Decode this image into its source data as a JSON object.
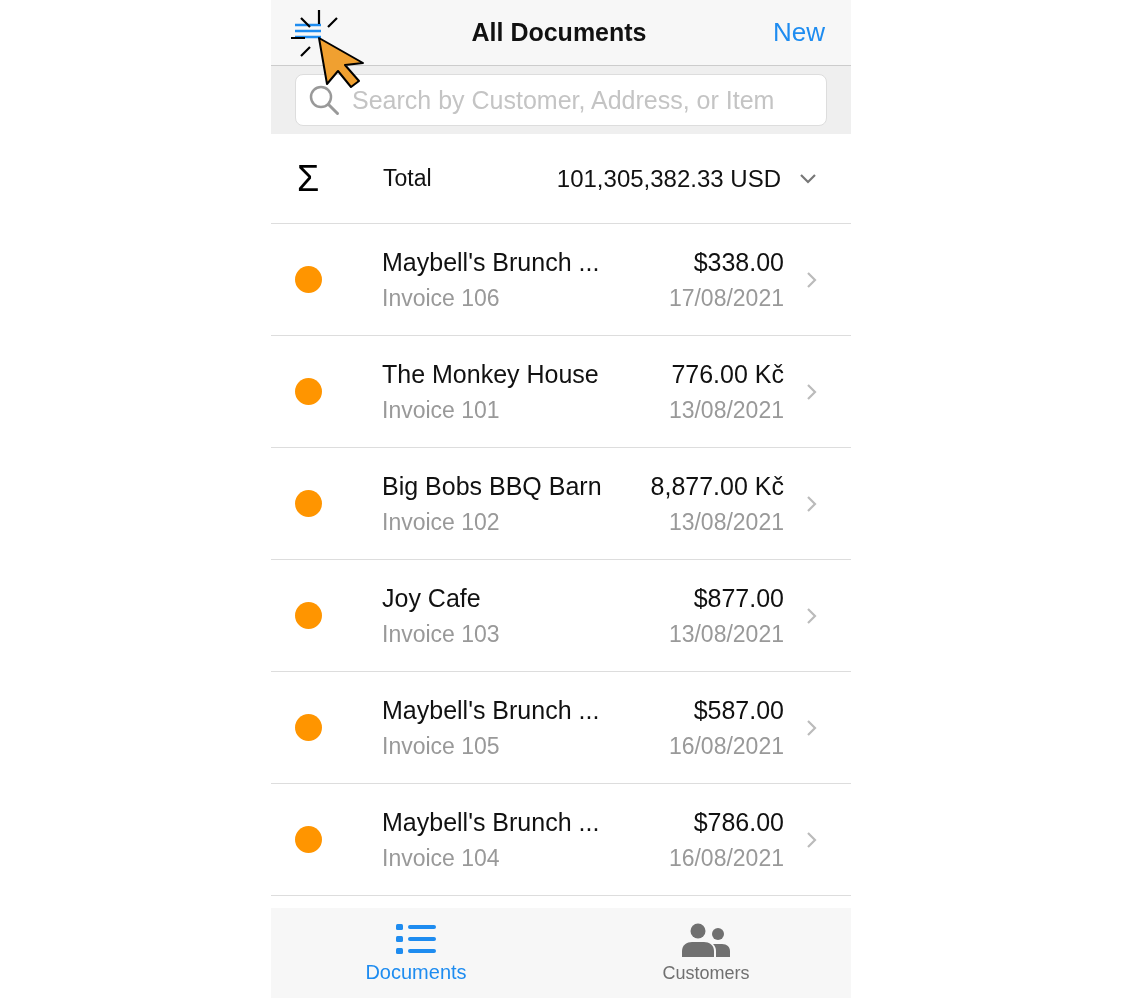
{
  "nav": {
    "title": "All Documents",
    "action": "New"
  },
  "search": {
    "placeholder": "Search by Customer, Address, or Item"
  },
  "total": {
    "symbol": "Σ",
    "label": "Total",
    "value": "101,305,382.33 USD"
  },
  "documents": [
    {
      "customer": "Maybell's Brunch ...",
      "number": "Invoice 106",
      "amount": "$338.00",
      "date": "17/08/2021",
      "color": "#ff9500"
    },
    {
      "customer": "The Monkey House",
      "number": "Invoice 101",
      "amount": "776.00 Kč",
      "date": "13/08/2021",
      "color": "#ff9500"
    },
    {
      "customer": "Big Bobs BBQ Barn",
      "number": "Invoice 102",
      "amount": "8,877.00 Kč",
      "date": "13/08/2021",
      "color": "#ff9500"
    },
    {
      "customer": "Joy Cafe",
      "number": "Invoice 103",
      "amount": "$877.00",
      "date": "13/08/2021",
      "color": "#ff9500"
    },
    {
      "customer": "Maybell's Brunch ...",
      "number": "Invoice 105",
      "amount": "$587.00",
      "date": "16/08/2021",
      "color": "#ff9500"
    },
    {
      "customer": "Maybell's Brunch ...",
      "number": "Invoice 104",
      "amount": "$786.00",
      "date": "16/08/2021",
      "color": "#ff9500"
    }
  ],
  "tabs": [
    {
      "kind": "documents",
      "label": "Documents",
      "selected": true
    },
    {
      "kind": "customers",
      "label": "Customers",
      "selected": false
    }
  ]
}
